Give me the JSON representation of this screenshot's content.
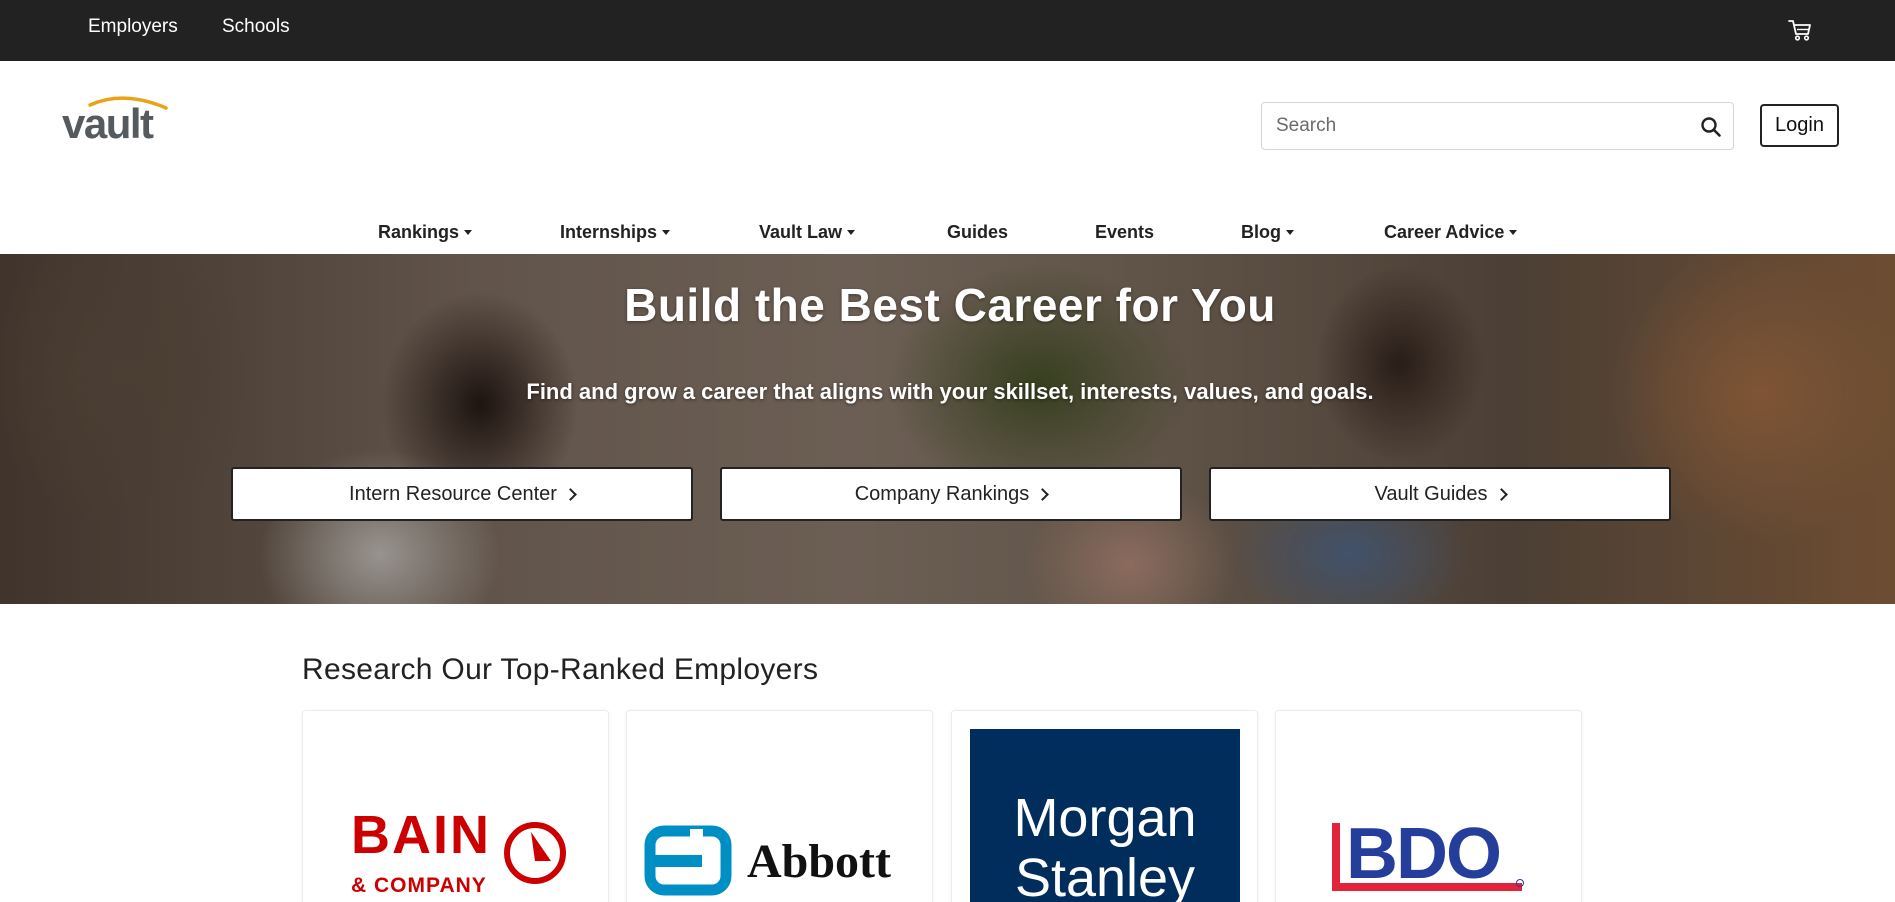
{
  "topbar": {
    "links": [
      "Employers",
      "Schools"
    ],
    "cart_icon": "cart-icon"
  },
  "header": {
    "logo_text": "vault",
    "search": {
      "placeholder": "Search",
      "value": "",
      "icon": "search-icon"
    },
    "login_label": "Login"
  },
  "nav": {
    "items": [
      {
        "label": "Rankings",
        "dropdown": true
      },
      {
        "label": "Internships",
        "dropdown": true
      },
      {
        "label": "Vault Law",
        "dropdown": true
      },
      {
        "label": "Guides",
        "dropdown": false
      },
      {
        "label": "Events",
        "dropdown": false
      },
      {
        "label": "Blog",
        "dropdown": true
      },
      {
        "label": "Career Advice",
        "dropdown": true
      }
    ]
  },
  "hero": {
    "title": "Build the Best Career for You",
    "subtitle": "Find and grow a career that aligns with your skillset, interests, values, and goals.",
    "buttons": [
      {
        "label": "Intern Resource Center"
      },
      {
        "label": "Company Rankings"
      },
      {
        "label": "Vault Guides"
      }
    ]
  },
  "employers": {
    "title": "Research Our Top-Ranked Employers",
    "cards": [
      {
        "logo_line1": "BAIN",
        "logo_line2": "& COMPANY",
        "color": "#cc0000"
      },
      {
        "logo_text": "Abbott",
        "color": "#008fc5"
      },
      {
        "logo_line1": "Morgan",
        "logo_line2": "Stanley",
        "color": "#002d5c"
      },
      {
        "logo_text": "BDO",
        "color": "#253e9b",
        "accent": "#e1243b"
      }
    ]
  },
  "colors": {
    "topbar_bg": "#222222",
    "logo_gold": "#e8a317",
    "logo_gray": "#555a5e"
  }
}
